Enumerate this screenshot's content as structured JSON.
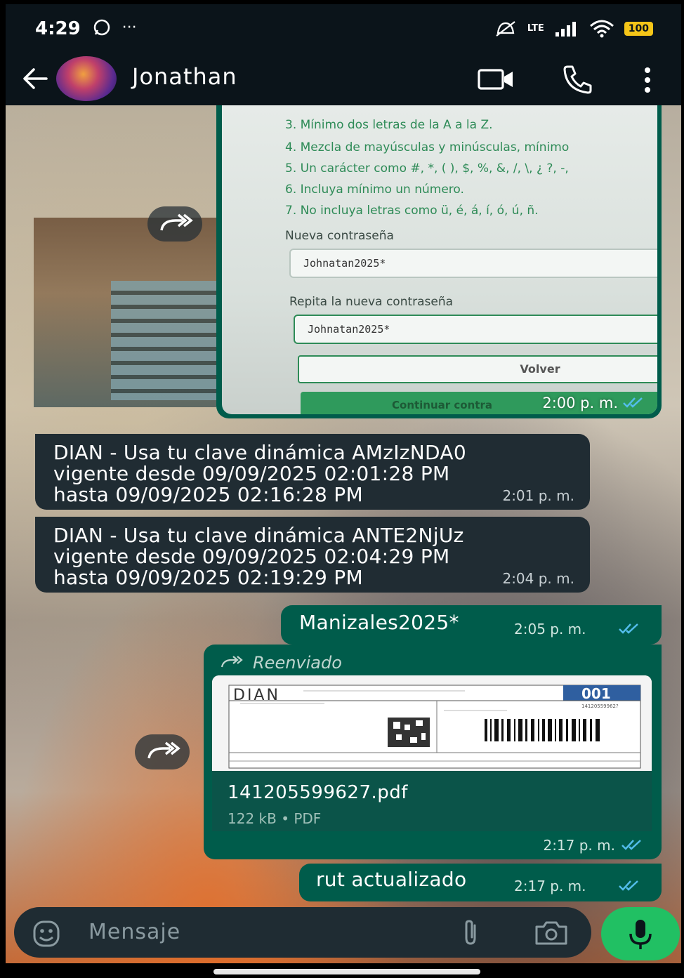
{
  "status_bar": {
    "time": "4:29",
    "battery": "100",
    "network": "LTE"
  },
  "header": {
    "contact_name": "Jonathan"
  },
  "image_message": {
    "rules": [
      "3. Mínimo dos letras de la A a la Z.",
      "4. Mezcla de mayúsculas y minúsculas, mínimo",
      "5. Un carácter como #, *, ( ), $, %, &, /, \\, ¿ ?, -,",
      "6. Incluya mínimo un número.",
      "7. No incluya letras como ü, é, á, í, ó, ú, ñ."
    ],
    "new_password_label": "Nueva contraseña",
    "new_password_value": "Johnatan2025*",
    "repeat_password_label": "Repita la nueva contraseña",
    "repeat_password_value": "Johnatan2025*",
    "back_button": "Volver",
    "continue_button": "Continuar contra",
    "time": "2:00 p. m."
  },
  "messages": [
    {
      "text_lines": [
        "DIAN - Usa tu clave dinámica AMzIzNDA0",
        "vigente desde 09/09/2025 02:01:28 PM",
        "hasta 09/09/2025 02:16:28 PM"
      ],
      "time": "2:01 p. m."
    },
    {
      "text_lines": [
        "DIAN - Usa tu clave dinámica ANTE2NjUz",
        "vigente desde 09/09/2025 02:04:29 PM",
        "hasta 09/09/2025 02:19:29 PM"
      ],
      "time": "2:04 p. m."
    }
  ],
  "sent_1": {
    "text": "Manizales2025*",
    "time": "2:05 p. m."
  },
  "document": {
    "forwarded_label": "Reenviado",
    "preview_logo": "DIAN",
    "preview_number": "001",
    "preview_nit": "14120559962?",
    "file_name": "141205599627.pdf",
    "meta": "122 kB • PDF",
    "time": "2:17 p. m."
  },
  "sent_2": {
    "text": "rut actualizado",
    "time": "2:17 p. m."
  },
  "input": {
    "placeholder": "Mensaje"
  },
  "colors": {
    "sent_bubble": "#005c4b",
    "received_bubble": "#202c33",
    "mic": "#21c063",
    "ticks": "#53bdeb"
  },
  "icons": [
    "back-arrow-icon",
    "video-call-icon",
    "phone-icon",
    "more-vert-icon",
    "forward-icon",
    "emoji-icon",
    "attach-icon",
    "camera-icon",
    "mic-icon",
    "double-check-icon"
  ]
}
